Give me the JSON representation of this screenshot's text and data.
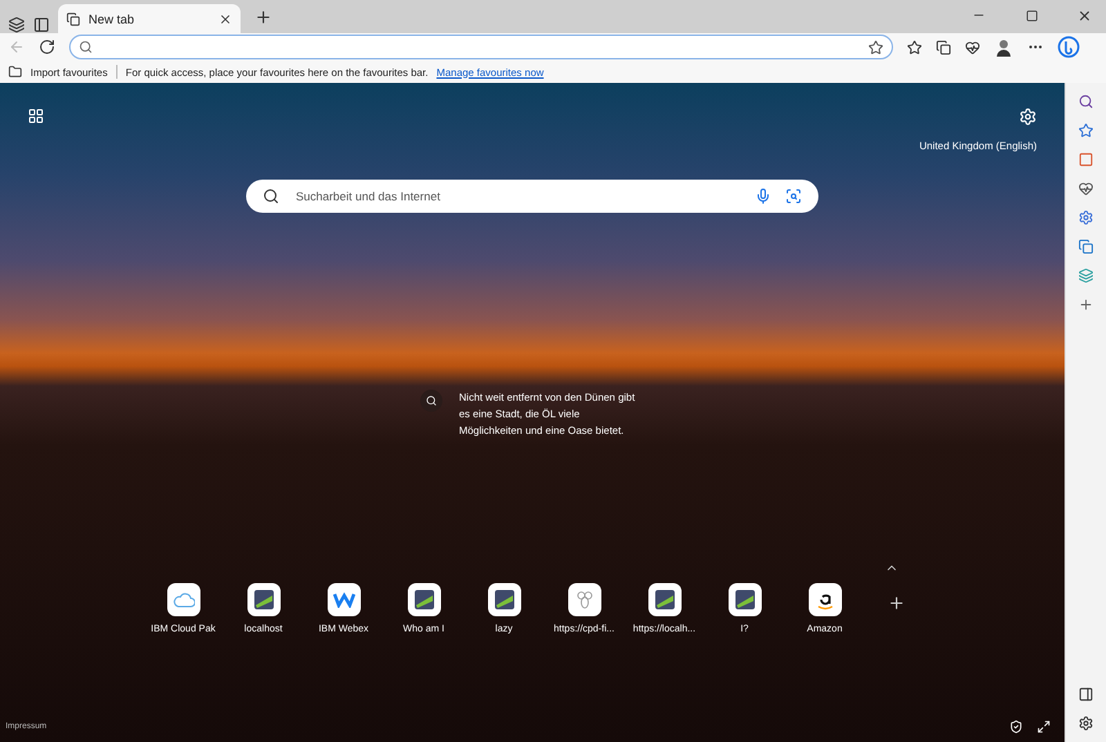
{
  "tabs": [
    {
      "label": "New tab",
      "selected": true
    }
  ],
  "favourites_bar": {
    "import_label": "Import favourites",
    "message": "For quick access, place your favourites here on the favourites bar.",
    "link": "Manage favourites now"
  },
  "new_tab_page": {
    "region": "United Kingdom (English)",
    "search": {
      "placeholder": "Sucharbeit und das Internet"
    },
    "caption": "Nicht weit entfernt von den Dünen gibt es eine Stadt, die ÖL viele Möglichkeiten und eine Oase bietet.",
    "quick_links": [
      {
        "label": "IBM Cloud Pak",
        "kind": "cloud"
      },
      {
        "label": "localhost",
        "kind": "product"
      },
      {
        "label": "IBM Webex",
        "kind": "webex"
      },
      {
        "label": "Who am I",
        "kind": "product"
      },
      {
        "label": "lazy",
        "kind": "product"
      },
      {
        "label": "https://cpd-fi...",
        "kind": "bee"
      },
      {
        "label": "https://localh...",
        "kind": "product"
      },
      {
        "label": "I?",
        "kind": "product"
      },
      {
        "label": "Amazon",
        "kind": "amazon"
      }
    ],
    "footer_link": "Impressum"
  }
}
